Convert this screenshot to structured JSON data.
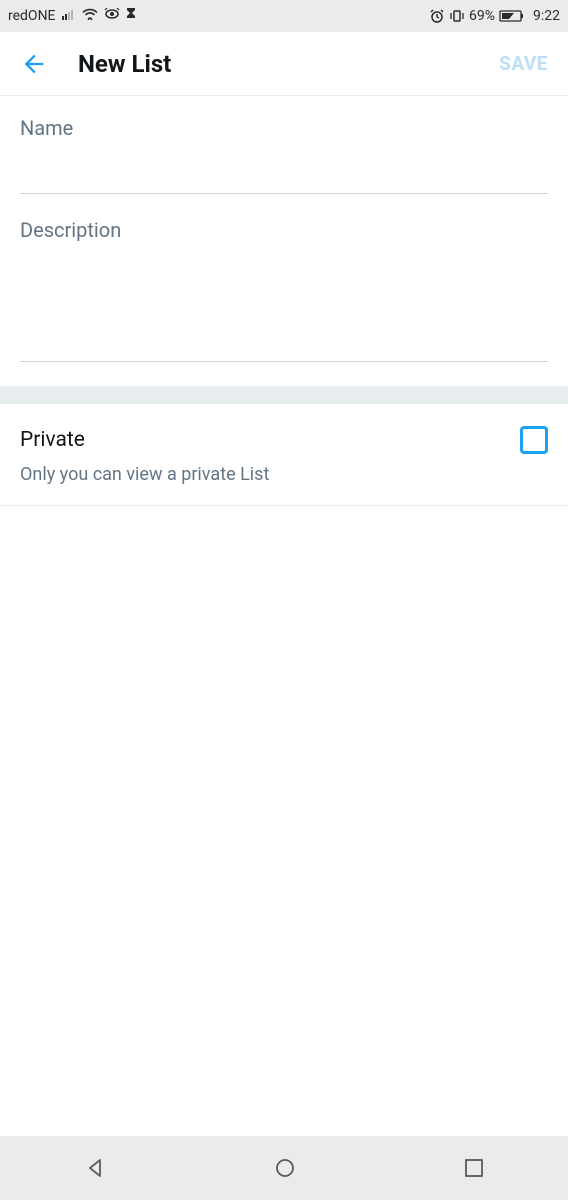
{
  "status_bar": {
    "carrier": "redONE",
    "battery": "69%",
    "time": "9:22"
  },
  "header": {
    "title": "New List",
    "save_label": "SAVE"
  },
  "form": {
    "name_label": "Name",
    "description_label": "Description"
  },
  "private_section": {
    "label": "Private",
    "help_text": "Only you can view a private List"
  }
}
